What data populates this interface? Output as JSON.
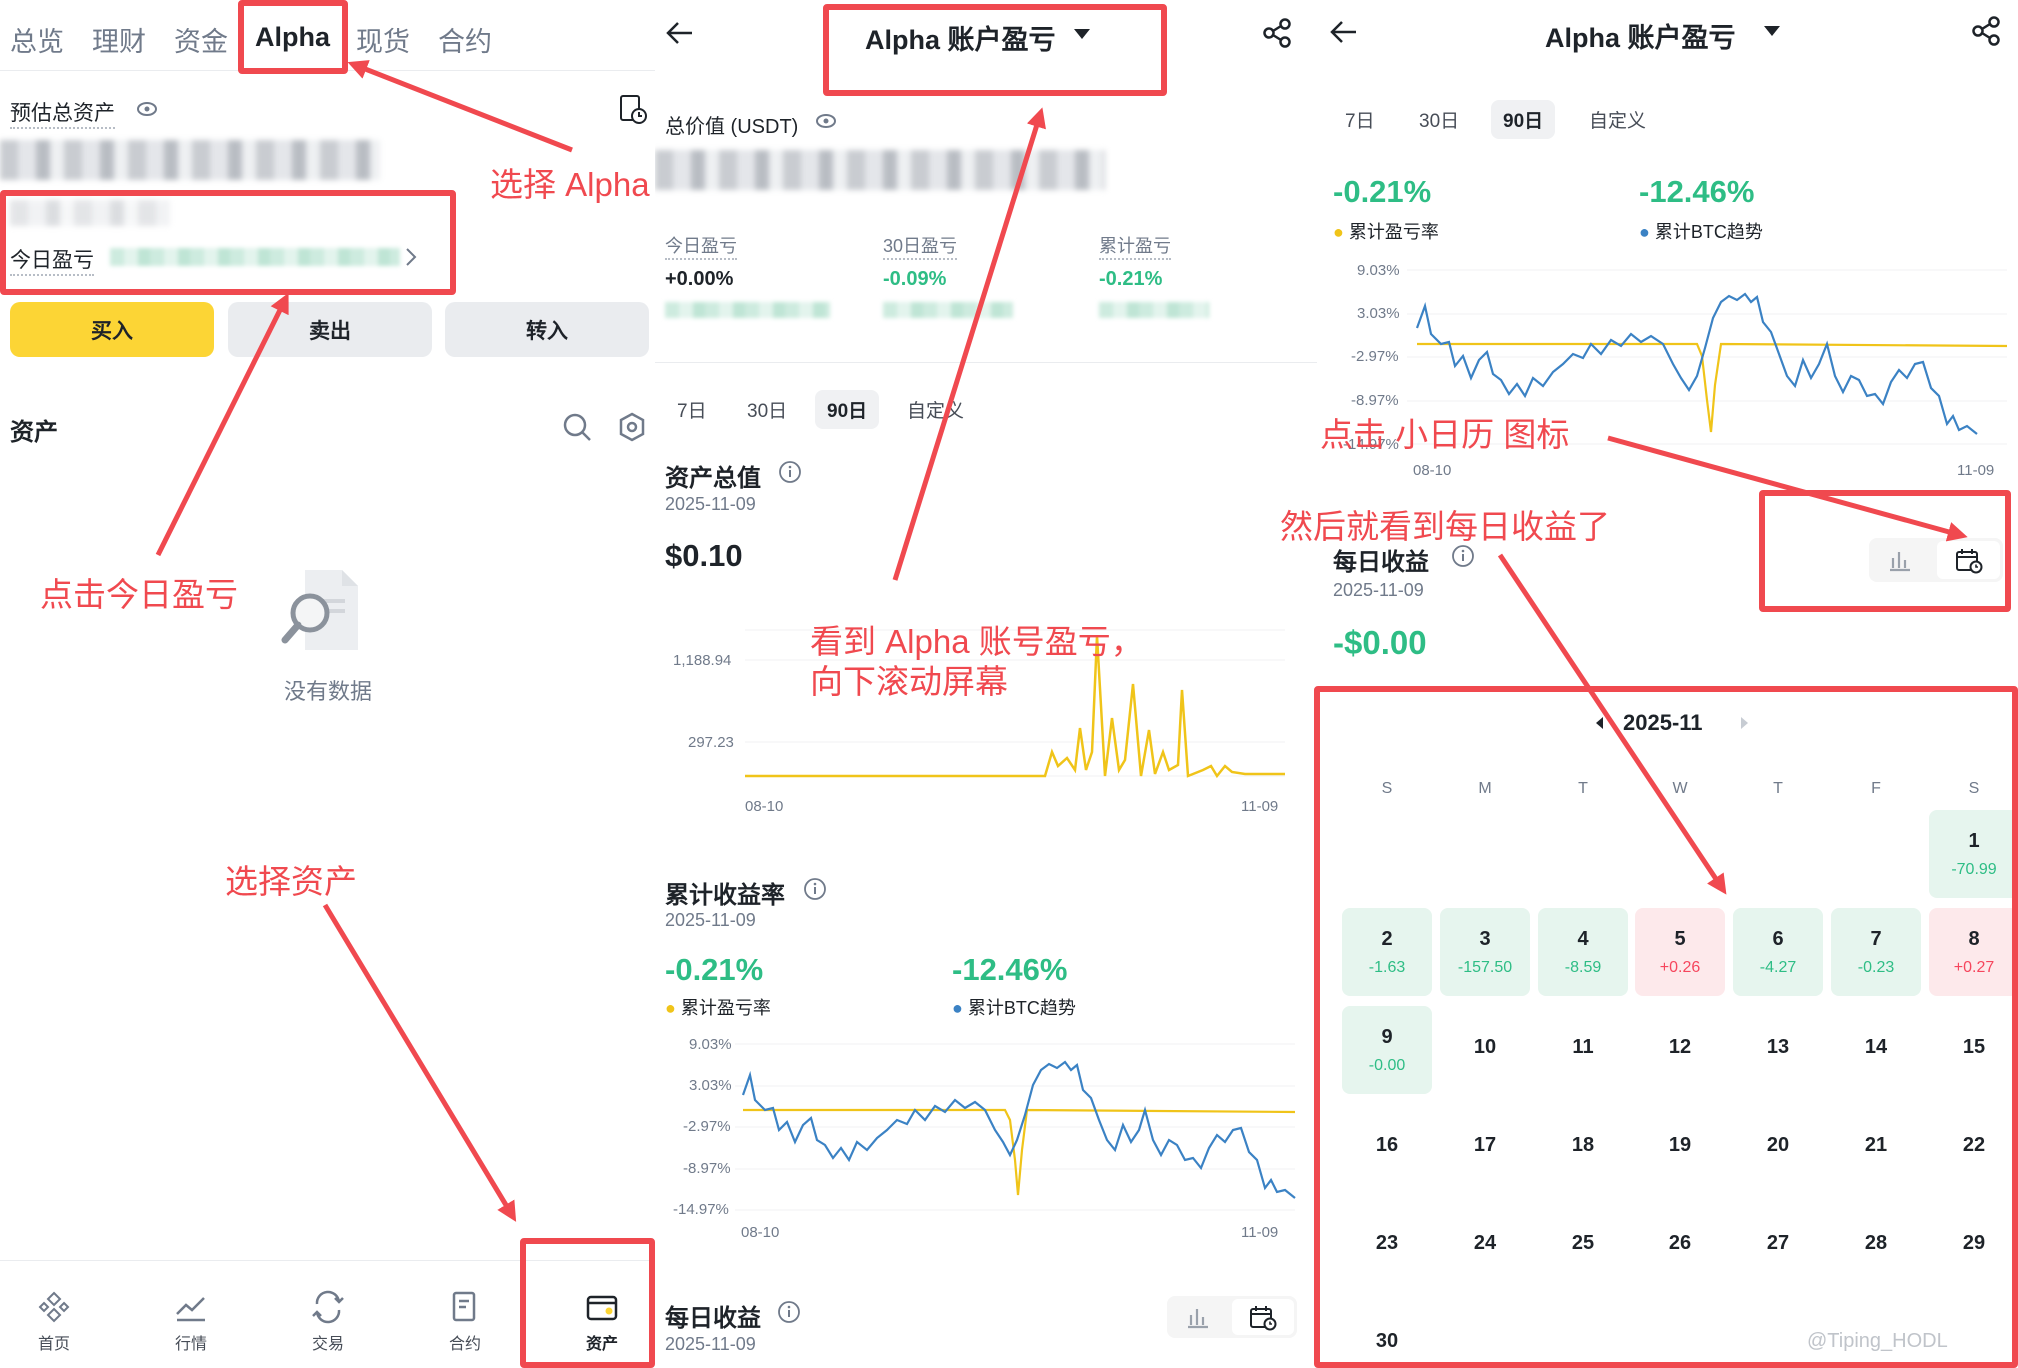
{
  "panel1": {
    "top_tabs": [
      "总览",
      "理财",
      "资金",
      "Alpha",
      "现货",
      "合约"
    ],
    "active_tab": "Alpha",
    "estimated_total_label": "预估总资产",
    "today_pnl_label": "今日盈亏",
    "buttons": {
      "buy": "买入",
      "sell": "卖出",
      "transfer": "转入"
    },
    "assets_label": "资产",
    "no_data": "没有数据",
    "bottom_nav": [
      "首页",
      "行情",
      "交易",
      "合约",
      "资产"
    ],
    "accent": "#fcd535"
  },
  "panel2": {
    "title": "Alpha 账户盈亏",
    "total_value_label": "总价值 (USDT)",
    "stats": [
      {
        "label": "今日盈亏",
        "value": "+0.00%"
      },
      {
        "label": "30日盈亏",
        "value": "-0.09%"
      },
      {
        "label": "累计盈亏",
        "value": "-0.21%"
      }
    ],
    "ranges": [
      "7日",
      "30日",
      "90日",
      "自定义"
    ],
    "active_range": "90日",
    "total_assets": {
      "label": "资产总值",
      "date": "2025-11-09",
      "value": "$0.10"
    },
    "asset_chart": {
      "y_ticks": [
        "1,188.94",
        "297.23"
      ],
      "x_start": "08-10",
      "x_end": "11-09"
    },
    "cum_return": {
      "label": "累计收益率",
      "date": "2025-11-09",
      "pnl_rate": "-0.21%",
      "pnl_rate_label": "累计盈亏率",
      "btc": "-12.46%",
      "btc_label": "累计BTC趋势",
      "y_ticks": [
        "9.03%",
        "3.03%",
        "-2.97%",
        "-8.97%",
        "-14.97%"
      ],
      "x_start": "08-10",
      "x_end": "11-09"
    },
    "daily": {
      "label": "每日收益",
      "date": "2025-11-09"
    }
  },
  "panel3": {
    "title": "Alpha 账户盈亏",
    "ranges": [
      "7日",
      "30日",
      "90日",
      "自定义"
    ],
    "active_range": "90日",
    "pnl_rate": "-0.21%",
    "pnl_rate_label": "累计盈亏率",
    "btc": "-12.46%",
    "btc_label": "累计BTC趋势",
    "y_ticks": [
      "9.03%",
      "3.03%",
      "-2.97%",
      "-8.97%",
      "-14.97%"
    ],
    "x_start": "08-10",
    "x_end": "11-09",
    "daily": {
      "label": "每日收益",
      "date": "2025-11-09",
      "value": "-$0.00"
    },
    "calendar": {
      "month": "2025-11",
      "weekdays": [
        "S",
        "M",
        "T",
        "W",
        "T",
        "F",
        "S"
      ],
      "days": [
        {
          "d": "1",
          "v": "-70.99",
          "t": "g"
        },
        {
          "d": "2",
          "v": "-1.63",
          "t": "g"
        },
        {
          "d": "3",
          "v": "-157.50",
          "t": "g"
        },
        {
          "d": "4",
          "v": "-8.59",
          "t": "g"
        },
        {
          "d": "5",
          "v": "+0.26",
          "t": "r"
        },
        {
          "d": "6",
          "v": "-4.27",
          "t": "g"
        },
        {
          "d": "7",
          "v": "-0.23",
          "t": "g"
        },
        {
          "d": "8",
          "v": "+0.27",
          "t": "r"
        },
        {
          "d": "9",
          "v": "-0.00",
          "t": "g"
        },
        {
          "d": "10"
        },
        {
          "d": "11"
        },
        {
          "d": "12"
        },
        {
          "d": "13"
        },
        {
          "d": "14"
        },
        {
          "d": "15"
        },
        {
          "d": "16"
        },
        {
          "d": "17"
        },
        {
          "d": "18"
        },
        {
          "d": "19"
        },
        {
          "d": "20"
        },
        {
          "d": "21"
        },
        {
          "d": "22"
        },
        {
          "d": "23"
        },
        {
          "d": "24"
        },
        {
          "d": "25"
        },
        {
          "d": "26"
        },
        {
          "d": "27"
        },
        {
          "d": "28"
        },
        {
          "d": "29"
        },
        {
          "d": "30"
        }
      ]
    },
    "watermark": "@Tiping_HODL"
  },
  "annotations": {
    "select_alpha": "选择 Alpha",
    "click_today_pnl": "点击今日盈亏",
    "select_assets": "选择资产",
    "see_alpha_pnl_line1": "看到 Alpha 账号盈亏，",
    "see_alpha_pnl_line2": "向下滚动屏幕",
    "click_calendar": "点击 小日历 图标",
    "then_daily": "然后就看到每日收益了"
  },
  "colors": {
    "green": "#2ebd85",
    "red": "#f6465d",
    "yellow": "#f0c419",
    "blue": "#3b82c4",
    "annotation": "#f0494f"
  }
}
